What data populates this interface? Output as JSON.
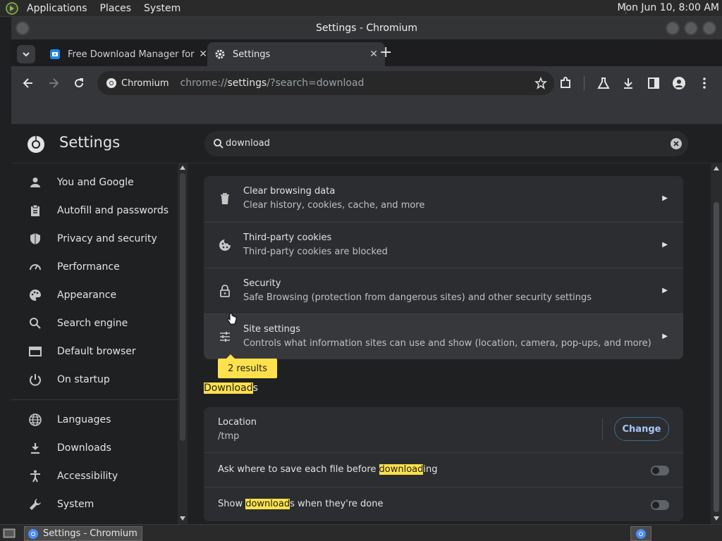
{
  "top_panel": {
    "menus": [
      "Applications",
      "Places",
      "System"
    ],
    "clock": "Mon Jun 10,  8:00 AM"
  },
  "window": {
    "title": "Settings - Chromium"
  },
  "tabs": [
    {
      "title": "Free Download Manager for L",
      "icon": "fdm-favicon",
      "active": false
    },
    {
      "title": "Settings",
      "icon": "gear-icon",
      "active": true
    }
  ],
  "toolbar": {
    "site_chip": "Chromium",
    "url_prefix": "chrome://",
    "url_host": "settings",
    "url_path": "/?search=download"
  },
  "settings": {
    "title": "Settings",
    "search_value": "download"
  },
  "sidebar": {
    "items": [
      {
        "label": "You and Google",
        "icon": "person-icon"
      },
      {
        "label": "Autofill and passwords",
        "icon": "clipboard-icon"
      },
      {
        "label": "Privacy and security",
        "icon": "shield-icon"
      },
      {
        "label": "Performance",
        "icon": "speedometer-icon"
      },
      {
        "label": "Appearance",
        "icon": "palette-icon"
      },
      {
        "label": "Search engine",
        "icon": "search-icon"
      },
      {
        "label": "Default browser",
        "icon": "browser-icon"
      },
      {
        "label": "On startup",
        "icon": "power-icon"
      },
      {
        "label": "Languages",
        "icon": "globe-icon"
      },
      {
        "label": "Downloads",
        "icon": "download-icon"
      },
      {
        "label": "Accessibility",
        "icon": "accessibility-icon"
      },
      {
        "label": "System",
        "icon": "wrench-icon"
      }
    ]
  },
  "privacy_rows": [
    {
      "title": "Clear browsing data",
      "subtitle": "Clear history, cookies, cache, and more",
      "icon": "trash-icon"
    },
    {
      "title": "Third-party cookies",
      "subtitle": "Third-party cookies are blocked",
      "icon": "cookie-icon"
    },
    {
      "title": "Security",
      "subtitle": "Safe Browsing (protection from dangerous sites) and other security settings",
      "icon": "lock-icon"
    },
    {
      "title": "Site settings",
      "subtitle": "Controls what information sites can use and show (location, camera, pop-ups, and more)",
      "icon": "sliders-icon"
    }
  ],
  "results_bubble": "2 results",
  "downloads": {
    "section_hl": "Download",
    "section_rest": "s",
    "location_label": "Location",
    "location_value": "/tmp",
    "change_label": "Change",
    "ask_pre": "Ask where to save each file before ",
    "ask_hl": "download",
    "ask_post": "ing",
    "ask_enabled": false,
    "show_pre": "Show ",
    "show_hl": "download",
    "show_post": "s when they're done",
    "show_enabled": false
  },
  "taskbar": {
    "item": "Settings - Chromium"
  },
  "colors": {
    "highlight": "#ffe14b",
    "accent": "#a8c7fa",
    "bg": "#1f2022",
    "card": "#2c2d30"
  }
}
